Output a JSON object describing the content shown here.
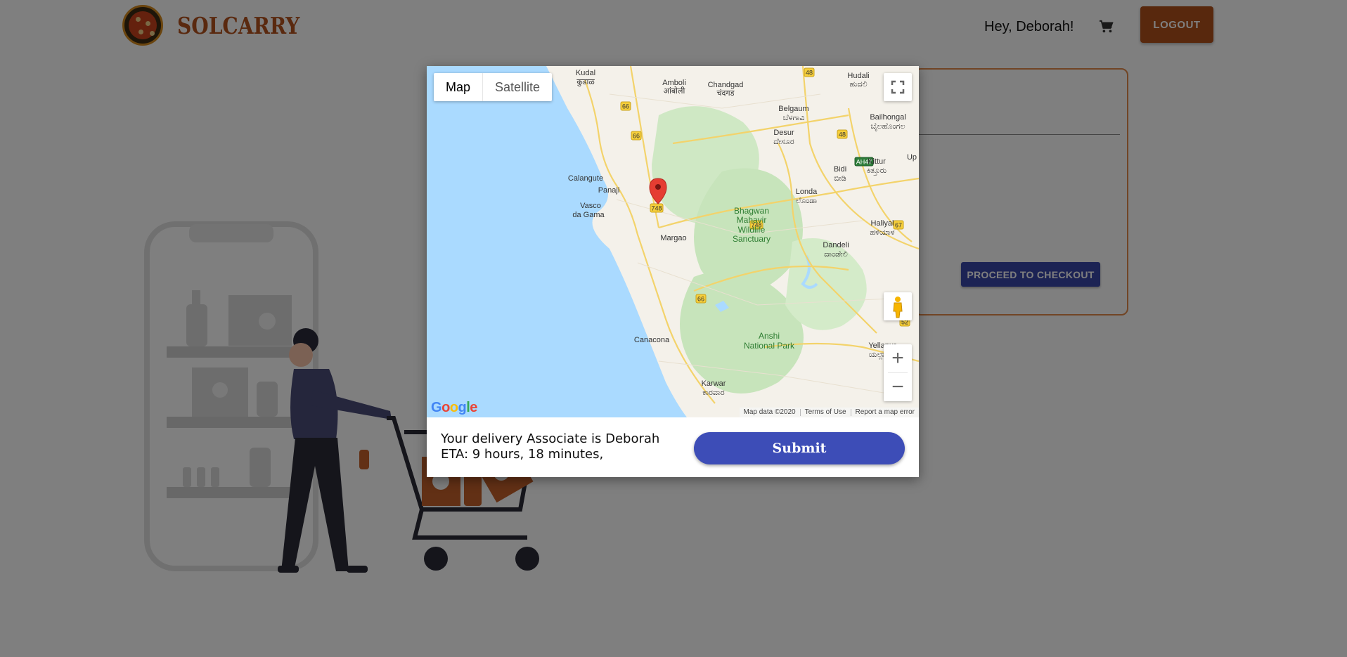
{
  "header": {
    "brand": "SOLCARRY",
    "greeting": "Hey,  Deborah!",
    "logout_label": "LOGOUT",
    "cart_icon": "shopping-cart-icon"
  },
  "cart": {
    "checkout_label": "PROCEED TO CHECKOUT"
  },
  "modal": {
    "map": {
      "type_options": [
        "Map",
        "Satellite"
      ],
      "selected_type": "Map",
      "marker": "location-pin-icon",
      "place_labels": [
        {
          "text": "Kudal"
        },
        {
          "text": "कुडाळ"
        },
        {
          "text": "Amboli"
        },
        {
          "text": "आंबोली"
        },
        {
          "text": "Chandgad"
        },
        {
          "text": "चंदगड"
        },
        {
          "text": "Hudali"
        },
        {
          "text": "ಹುದಲಿ"
        },
        {
          "text": "Belgaum"
        },
        {
          "text": "ಬೆಳಗಾವಿ"
        },
        {
          "text": "Bailhongal"
        },
        {
          "text": "ಬೈಲಹೊಂಗಲ"
        },
        {
          "text": "Desur"
        },
        {
          "text": "ದೇಸೂರ"
        },
        {
          "text": "Calangute"
        },
        {
          "text": "Panaji"
        },
        {
          "text": "Bidi"
        },
        {
          "text": "ಬೀಡಿ"
        },
        {
          "text": "Kittur"
        },
        {
          "text": "ಕಿತ್ತೂರು"
        },
        {
          "text": "Vasco"
        },
        {
          "text": "da Gama"
        },
        {
          "text": "Londa"
        },
        {
          "text": "ಲೊಂಡಾ"
        },
        {
          "text": "Bhagwan"
        },
        {
          "text": "Mahavir"
        },
        {
          "text": "Wildlife"
        },
        {
          "text": "Sanctuary"
        },
        {
          "text": "Haliyal"
        },
        {
          "text": "ಹಳಿಯಾಳ"
        },
        {
          "text": "Margao"
        },
        {
          "text": "Dandeli"
        },
        {
          "text": "ದಾಂಡೇಲಿ"
        },
        {
          "text": "Canacona"
        },
        {
          "text": "Anshi"
        },
        {
          "text": "National Park"
        },
        {
          "text": "Yellapur"
        },
        {
          "text": "ಯಲ್ಲಾಪುರ"
        },
        {
          "text": "Karwar"
        },
        {
          "text": "ಕಾರವಾರ"
        },
        {
          "text": "Up"
        }
      ],
      "road_shields": [
        "48",
        "66",
        "66",
        "48",
        "AH47",
        "748",
        "748",
        "67",
        "66",
        "52"
      ],
      "google_logo": "Google",
      "attribution": [
        "Map data ©2020",
        "Terms of Use",
        "Report a map error"
      ],
      "controls": {
        "fullscreen_icon": "fullscreen-icon",
        "pegman_icon": "street-view-pegman-icon",
        "zoom_in": "+",
        "zoom_out": "−"
      }
    },
    "delivery_text": "Your delivery Associate is Deborah",
    "eta_text": "ETA: 9 hours, 18 minutes,",
    "submit_label": "Submit"
  },
  "colors": {
    "brand": "#b5531f",
    "logout": "#b0501a",
    "checkout": "#3946a8",
    "submit": "#3d4db7",
    "map_water": "#aadaff",
    "overlay": "rgba(0,0,0,0.5)"
  }
}
